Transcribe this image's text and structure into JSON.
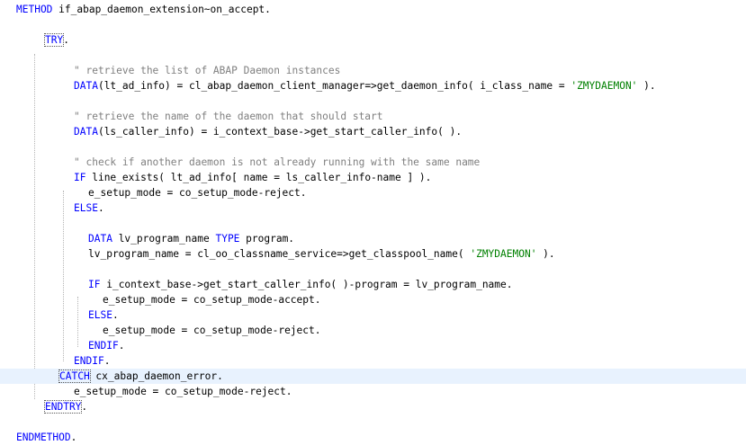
{
  "editor": {
    "lines": [
      {
        "indent": 0,
        "tokens": [
          {
            "t": "METHOD",
            "c": "kw"
          },
          {
            "t": " if_abap_daemon_extension~on_accept."
          }
        ]
      },
      {
        "indent": 0,
        "tokens": []
      },
      {
        "indent": 2,
        "tokens": [
          {
            "t": "TRY",
            "c": "kw boxed"
          },
          {
            "t": "."
          }
        ]
      },
      {
        "indent": 0,
        "tokens": []
      },
      {
        "indent": 4,
        "tokens": [
          {
            "t": "\" retrieve the list of ABAP Daemon instances",
            "c": "cm"
          }
        ]
      },
      {
        "indent": 4,
        "tokens": [
          {
            "t": "DATA",
            "c": "kw"
          },
          {
            "t": "(lt_ad_info) = cl_abap_daemon_client_manager=>get_daemon_info( i_class_name = "
          },
          {
            "t": "'ZMYDAEMON'",
            "c": "str"
          },
          {
            "t": " )."
          }
        ]
      },
      {
        "indent": 0,
        "tokens": []
      },
      {
        "indent": 4,
        "tokens": [
          {
            "t": "\" retrieve the name of the daemon that should start",
            "c": "cm"
          }
        ]
      },
      {
        "indent": 4,
        "tokens": [
          {
            "t": "DATA",
            "c": "kw"
          },
          {
            "t": "(ls_caller_info) = i_context_base->get_start_caller_info( )."
          }
        ]
      },
      {
        "indent": 0,
        "tokens": []
      },
      {
        "indent": 4,
        "tokens": [
          {
            "t": "\" check if another daemon is not already running with the same name",
            "c": "cm"
          }
        ]
      },
      {
        "indent": 4,
        "tokens": [
          {
            "t": "IF",
            "c": "kw"
          },
          {
            "t": " line_exists( lt_ad_info[ name = ls_caller_info-name ] )."
          }
        ]
      },
      {
        "indent": 5,
        "tokens": [
          {
            "t": "e_setup_mode = co_setup_mode-reject."
          }
        ]
      },
      {
        "indent": 4,
        "tokens": [
          {
            "t": "ELSE",
            "c": "kw"
          },
          {
            "t": "."
          }
        ]
      },
      {
        "indent": 0,
        "tokens": []
      },
      {
        "indent": 5,
        "tokens": [
          {
            "t": "DATA",
            "c": "kw"
          },
          {
            "t": " lv_program_name "
          },
          {
            "t": "TYPE",
            "c": "kw"
          },
          {
            "t": " program."
          }
        ]
      },
      {
        "indent": 5,
        "tokens": [
          {
            "t": "lv_program_name = cl_oo_classname_service=>get_classpool_name( "
          },
          {
            "t": "'ZMYDAEMON'",
            "c": "str"
          },
          {
            "t": " )."
          }
        ]
      },
      {
        "indent": 0,
        "tokens": []
      },
      {
        "indent": 5,
        "tokens": [
          {
            "t": "IF",
            "c": "kw"
          },
          {
            "t": " i_context_base->get_start_caller_info( )-program = lv_program_name."
          }
        ]
      },
      {
        "indent": 6,
        "tokens": [
          {
            "t": "e_setup_mode = co_setup_mode-accept."
          }
        ]
      },
      {
        "indent": 5,
        "tokens": [
          {
            "t": "ELSE",
            "c": "kw"
          },
          {
            "t": "."
          }
        ]
      },
      {
        "indent": 6,
        "tokens": [
          {
            "t": "e_setup_mode = co_setup_mode-reject."
          }
        ]
      },
      {
        "indent": 5,
        "tokens": [
          {
            "t": "ENDIF",
            "c": "kw"
          },
          {
            "t": "."
          }
        ]
      },
      {
        "indent": 4,
        "tokens": [
          {
            "t": "ENDIF",
            "c": "kw"
          },
          {
            "t": "."
          }
        ]
      },
      {
        "indent": 3,
        "current": true,
        "tokens": [
          {
            "t": "CATCH",
            "c": "kw boxed"
          },
          {
            "t": " cx_abap_daemon_error."
          }
        ]
      },
      {
        "indent": 4,
        "tokens": [
          {
            "t": "e_setup_mode = co_setup_mode-reject."
          }
        ]
      },
      {
        "indent": 2,
        "tokens": [
          {
            "t": "ENDTRY",
            "c": "kw boxed"
          },
          {
            "t": "."
          }
        ]
      },
      {
        "indent": 0,
        "tokens": []
      },
      {
        "indent": 0,
        "tokens": [
          {
            "t": "ENDMETHOD",
            "c": "kw"
          },
          {
            "t": "."
          }
        ]
      }
    ]
  }
}
